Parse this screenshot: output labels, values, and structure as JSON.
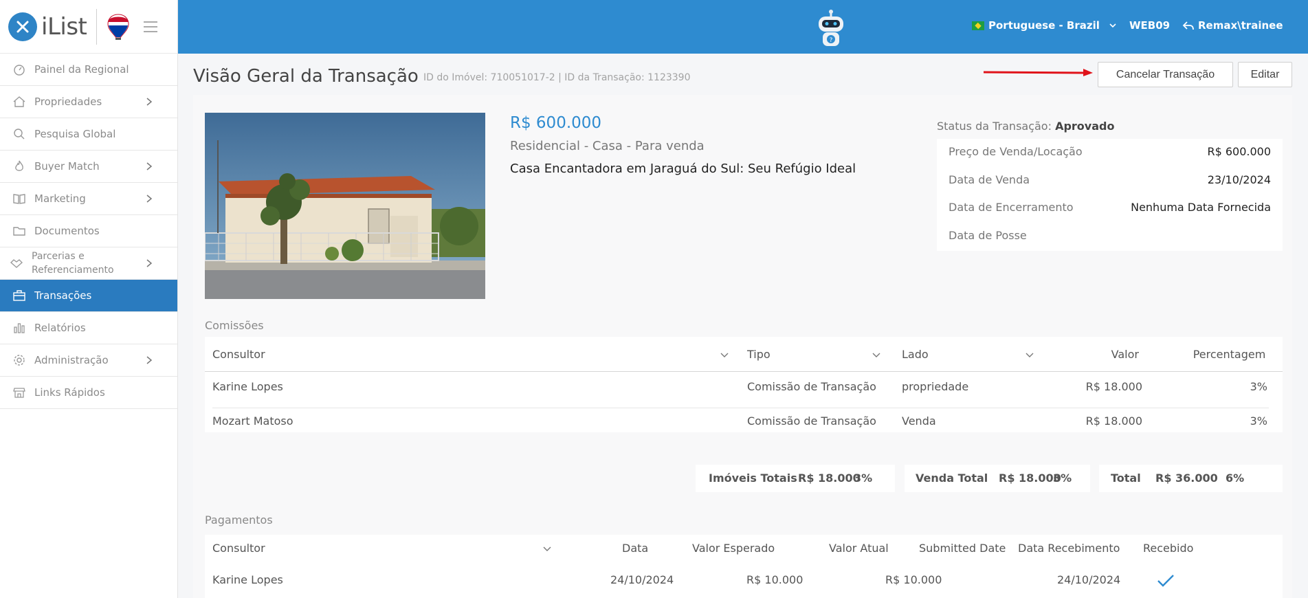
{
  "app": {
    "name": "iList"
  },
  "sidebar": {
    "items": [
      {
        "label": "Painel da Regional"
      },
      {
        "label": "Propriedades"
      },
      {
        "label": "Pesquisa Global"
      },
      {
        "label": "Buyer Match"
      },
      {
        "label": "Marketing"
      },
      {
        "label": "Documentos"
      },
      {
        "label": "Parcerias e Referenciamento"
      },
      {
        "label": "Transações"
      },
      {
        "label": "Relatórios"
      },
      {
        "label": "Administração"
      },
      {
        "label": "Links Rápidos"
      }
    ]
  },
  "header": {
    "language": "Portuguese - Brazil",
    "office": "WEB09",
    "user": "Remax\\trainee"
  },
  "page": {
    "title": "Visão Geral da Transação",
    "subtitle": "ID do Imóvel: 710051017-2 | ID da Transação: 1123390",
    "cancel_label": "Cancelar Transação",
    "edit_label": "Editar"
  },
  "property": {
    "price": "R$ 600.000",
    "type": "Residencial - Casa - Para venda",
    "title": "Casa Encantadora em Jaraguá do Sul: Seu Refúgio Ideal"
  },
  "status": {
    "label": "Status da Transação:",
    "value": "Aprovado"
  },
  "details": [
    {
      "label": "Preço de Venda/Locação",
      "value": "R$ 600.000"
    },
    {
      "label": "Data de Venda",
      "value": "23/10/2024"
    },
    {
      "label": "Data de Encerramento",
      "value": "Nenhuma Data Fornecida"
    },
    {
      "label": "Data de Posse",
      "value": ""
    }
  ],
  "commissions": {
    "label": "Comissões",
    "headers": {
      "consultor": "Consultor",
      "tipo": "Tipo",
      "lado": "Lado",
      "valor": "Valor",
      "percentagem": "Percentagem"
    },
    "rows": [
      {
        "consultor": "Karine Lopes",
        "tipo": "Comissão de Transação",
        "lado": "propriedade",
        "valor": "R$ 18.000",
        "percentagem": "3%"
      },
      {
        "consultor": "Mozart Matoso",
        "tipo": "Comissão de Transação",
        "lado": "Venda",
        "valor": "R$ 18.000",
        "percentagem": "3%"
      }
    ],
    "totals": [
      {
        "label": "Imóveis Totais",
        "value": "R$ 18.000",
        "pct": "3%"
      },
      {
        "label": "Venda Total",
        "value": "R$ 18.000",
        "pct": "3%"
      },
      {
        "label": "Total",
        "value": "R$ 36.000",
        "pct": "6%"
      }
    ]
  },
  "payments": {
    "label": "Pagamentos",
    "headers": {
      "consultor": "Consultor",
      "data": "Data",
      "valor_esperado": "Valor Esperado",
      "valor_atual": "Valor Atual",
      "submitted": "Submitted Date",
      "recebimento": "Data Recebimento",
      "recebido": "Recebido"
    },
    "rows": [
      {
        "consultor": "Karine Lopes",
        "data": "24/10/2024",
        "valor_esperado": "R$ 10.000",
        "valor_atual": "R$ 10.000",
        "submitted": "",
        "recebimento": "24/10/2024"
      }
    ]
  }
}
